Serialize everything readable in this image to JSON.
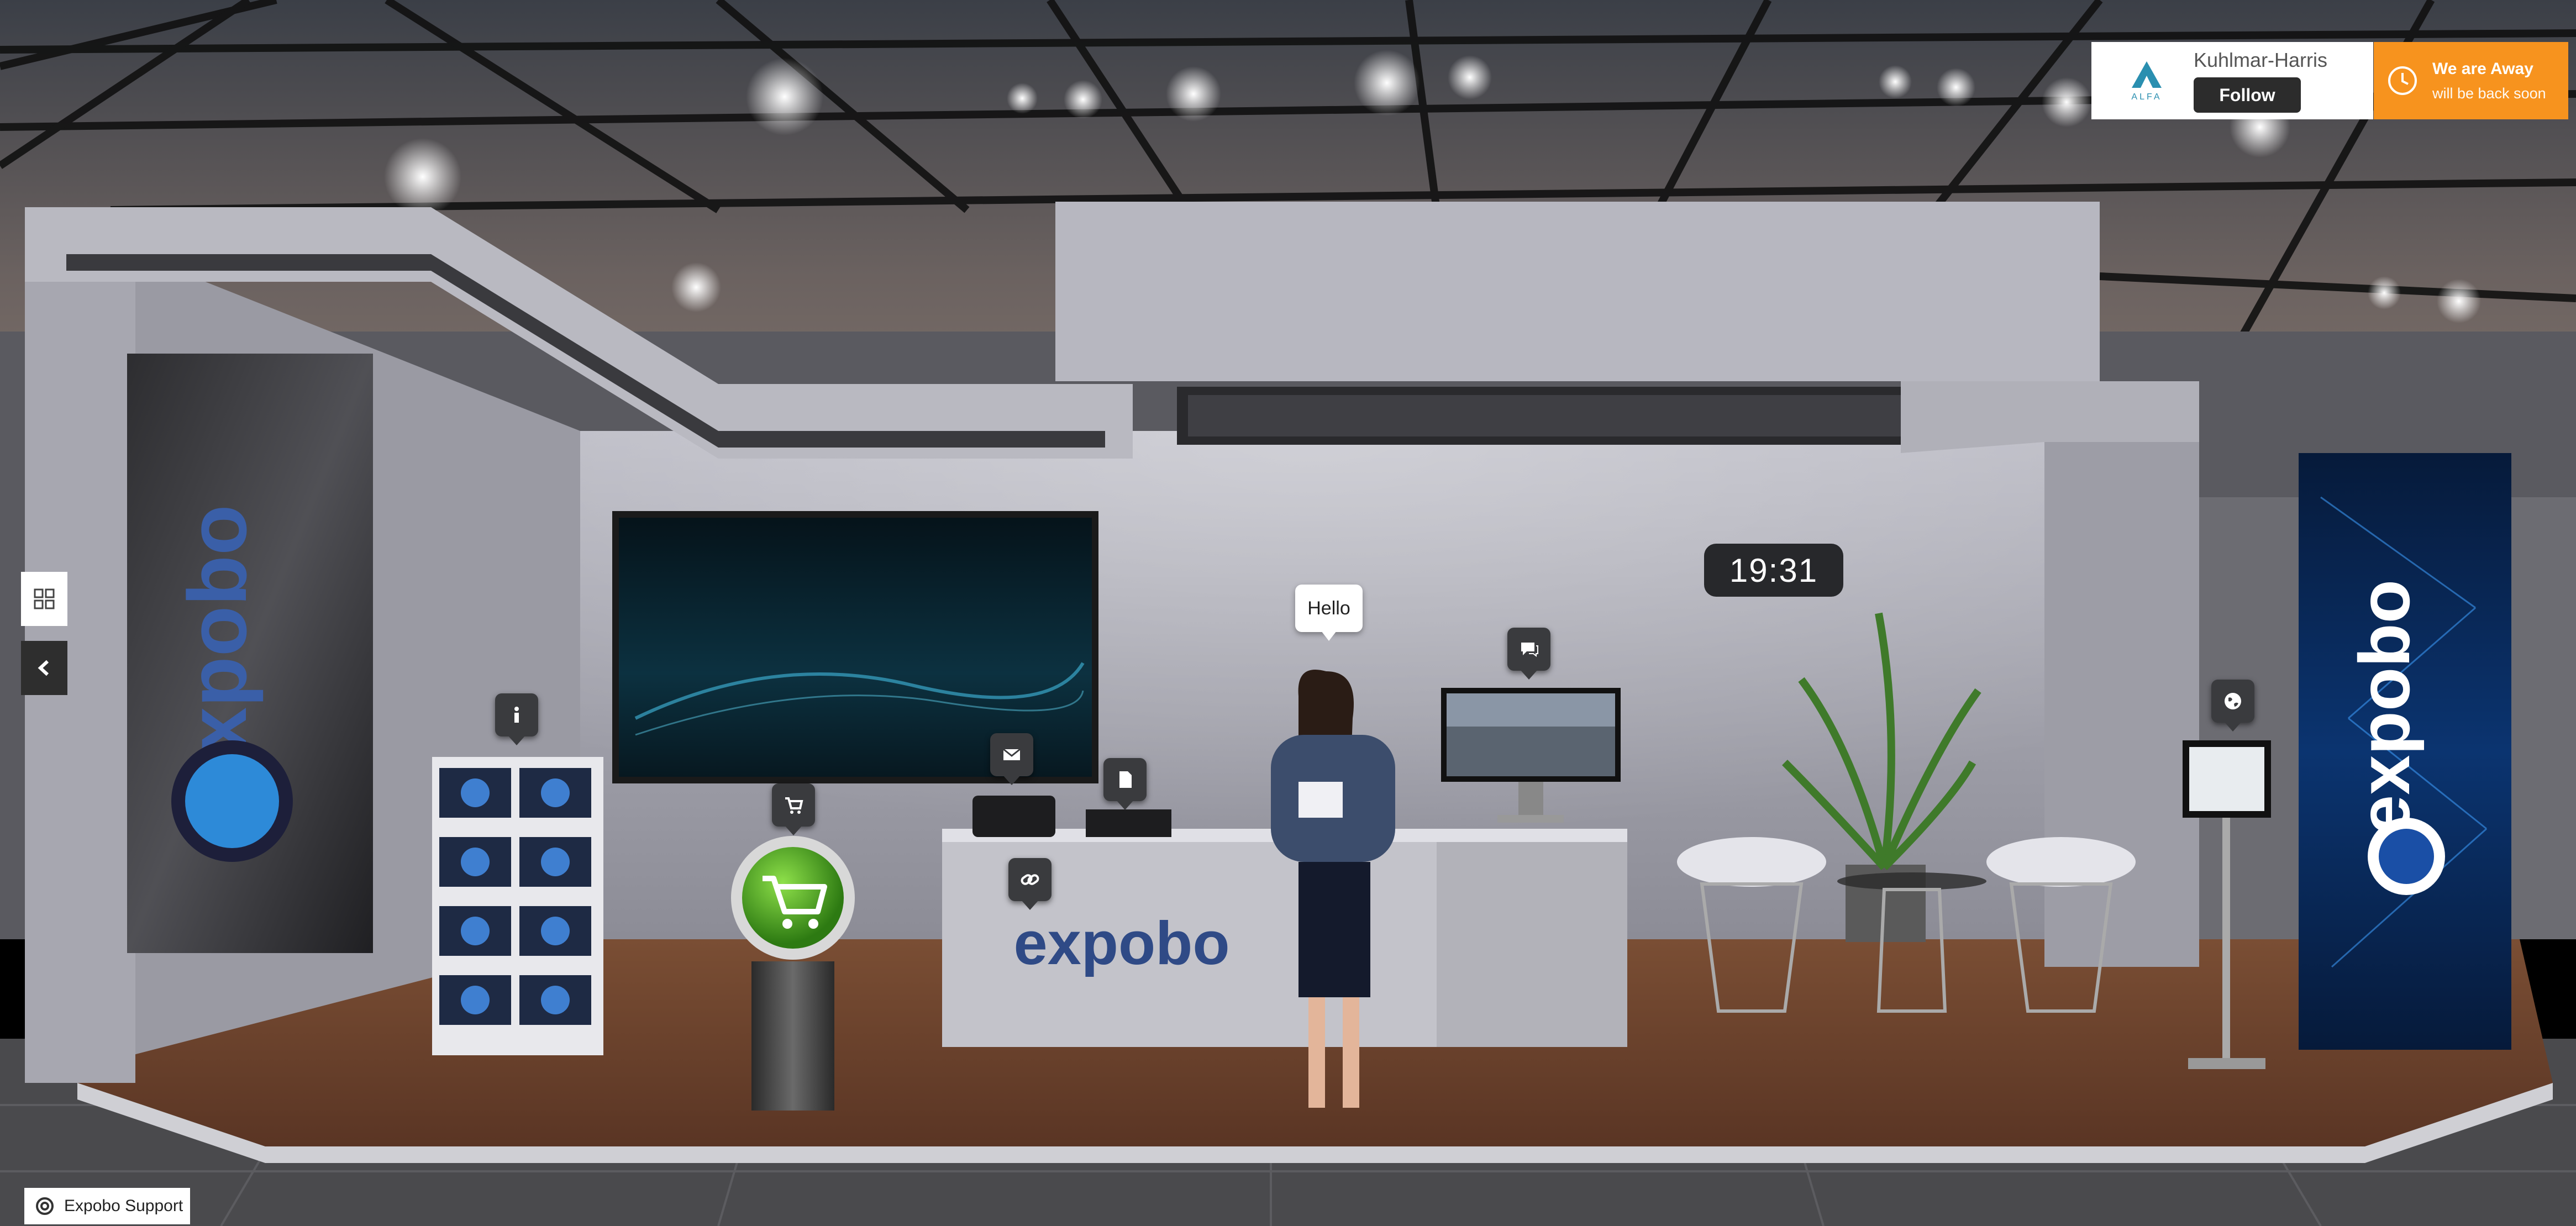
{
  "brand_panel": {
    "company_name": "Kuhlmar-Harris",
    "follow_label": "Follow",
    "logo_text": "ALFA"
  },
  "status_panel": {
    "title": "We are Away",
    "subtitle": "will be back soon",
    "color": "#f7931e"
  },
  "booth": {
    "clock": "19:31",
    "greeting": "Hello",
    "brand_text": "expobo"
  },
  "support": {
    "label": "Expobo Support"
  },
  "hotspots": [
    {
      "name": "info-hotspot",
      "icon": "info-icon"
    },
    {
      "name": "shop-hotspot",
      "icon": "shopping-cart-icon"
    },
    {
      "name": "email-hotspot",
      "icon": "envelope-icon"
    },
    {
      "name": "document-hotspot",
      "icon": "document-icon"
    },
    {
      "name": "link-hotspot",
      "icon": "link-icon"
    },
    {
      "name": "chat-hotspot",
      "icon": "chat-icon"
    },
    {
      "name": "web-hotspot",
      "icon": "globe-icon"
    }
  ]
}
